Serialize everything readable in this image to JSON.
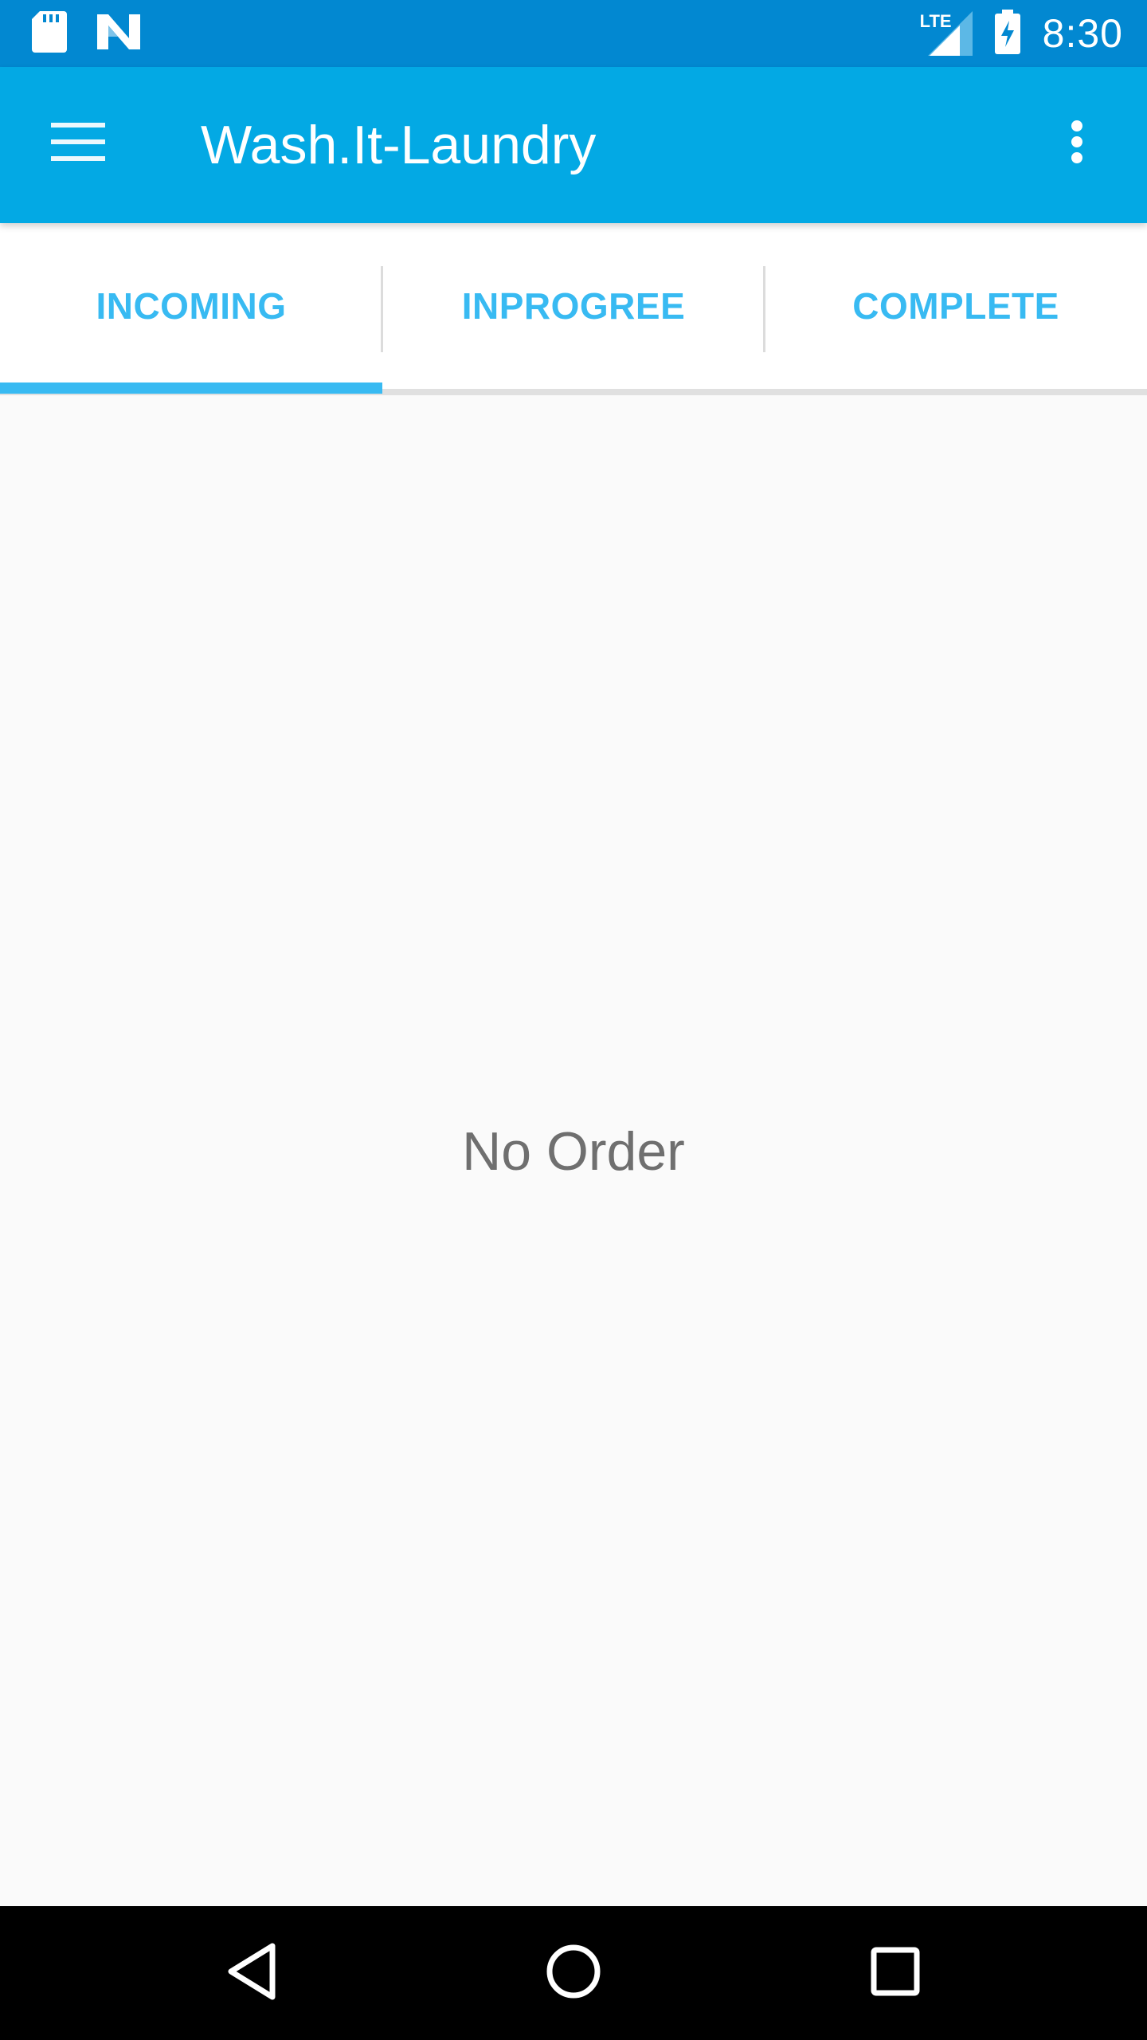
{
  "status_bar": {
    "time": "8:30",
    "network_label": "LTE",
    "left_icons": [
      "sd-card-icon",
      "n-notification-icon"
    ],
    "right_icons": [
      "lte-signal-icon",
      "battery-charging-icon"
    ]
  },
  "app_bar": {
    "title": "Wash.It-Laundry",
    "menu_icon": "hamburger-menu-icon",
    "overflow_icon": "more-vert-icon",
    "color": "#03a9e4"
  },
  "tabs": [
    {
      "label": "INCOMING",
      "selected": true
    },
    {
      "label": "INPROGREE",
      "selected": false
    },
    {
      "label": "COMPLETE",
      "selected": false
    }
  ],
  "content": {
    "empty_message": "No Order"
  },
  "nav_bar": {
    "icons": [
      "back-icon",
      "home-icon",
      "recents-icon"
    ]
  },
  "colors": {
    "status_bar": "#0288d1",
    "app_bar": "#03a9e4",
    "tab_text": "#38baf2",
    "tab_indicator": "#38baf2",
    "empty_text": "#6f6f6f"
  }
}
